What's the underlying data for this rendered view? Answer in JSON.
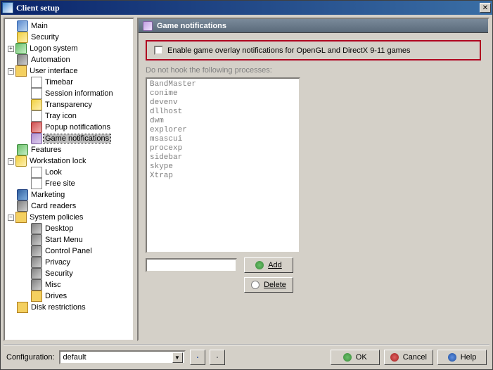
{
  "window": {
    "title": "Client setup"
  },
  "tree": {
    "main": "Main",
    "security": "Security",
    "logon": "Logon system",
    "automation": "Automation",
    "ui": "User interface",
    "ui_children": {
      "timebar": "Timebar",
      "session": "Session information",
      "transparency": "Transparency",
      "tray": "Tray icon",
      "popup": "Popup notifications",
      "game": "Game notifications"
    },
    "features": "Features",
    "wlock": "Workstation lock",
    "wlock_children": {
      "look": "Look",
      "free": "Free site"
    },
    "marketing": "Marketing",
    "card": "Card readers",
    "policies": "System policies",
    "policies_children": {
      "desktop": "Desktop",
      "start": "Start Menu",
      "cp": "Control Panel",
      "privacy": "Privacy",
      "sec": "Security",
      "misc": "Misc",
      "drives": "Drives"
    },
    "disk": "Disk restrictions"
  },
  "panel": {
    "header": "Game notifications",
    "checkbox_label": "Enable game overlay notifications for OpenGL and DirectX 9-11 games",
    "exclude_label": "Do not hook the following processes:",
    "processes": [
      "BandMaster",
      "conime",
      "devenv",
      "dllhost",
      "dwm",
      "explorer",
      "msascui",
      "procexp",
      "sidebar",
      "skype",
      "Xtrap"
    ],
    "add": "Add",
    "delete": "Delete"
  },
  "bottom": {
    "config_label": "Configuration:",
    "config_value": "default",
    "ok": "OK",
    "cancel": "Cancel",
    "help": "Help"
  }
}
